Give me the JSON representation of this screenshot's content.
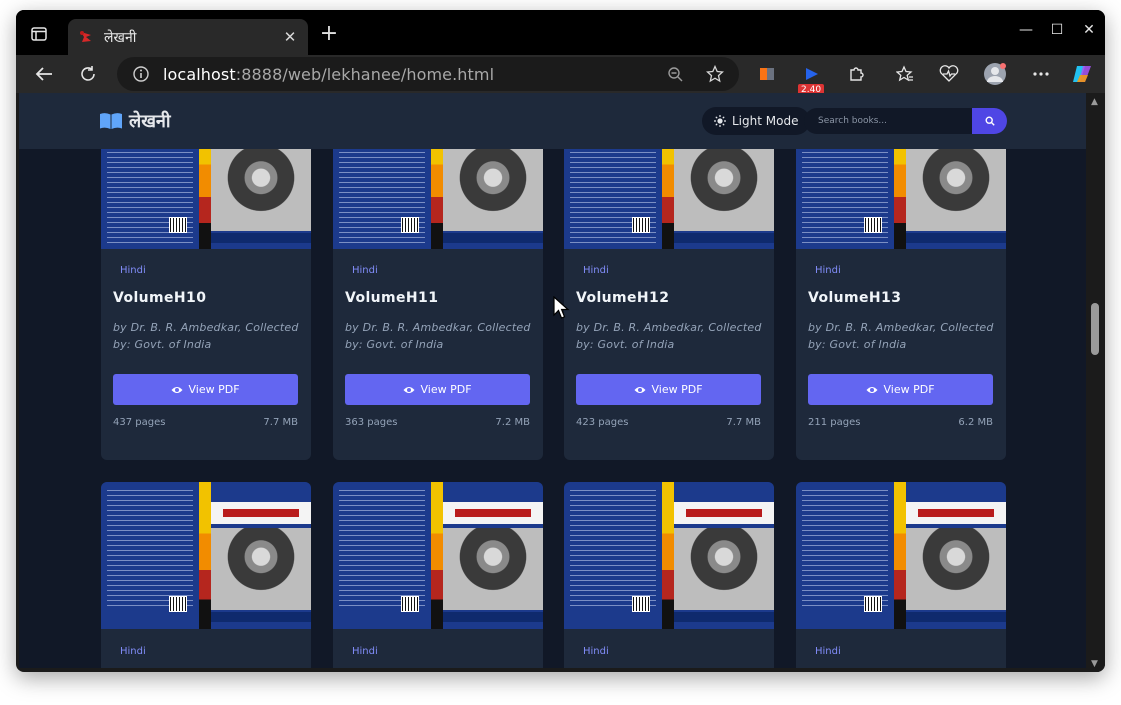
{
  "browser": {
    "tab_title": "लेखनी",
    "new_tab": "+",
    "url_host": "localhost",
    "url_path": ":8888/web/lekhanee/home.html",
    "extension_badge": "2.40",
    "window_controls": [
      "—",
      "☐",
      "✕"
    ]
  },
  "app": {
    "logo_text": "लेखनी",
    "mode_button": "Light Mode",
    "search_placeholder": "Search books..."
  },
  "books": [
    {
      "language": "Hindi",
      "title": "VolumeH10",
      "author": "by Dr. B. R. Ambedkar, Collected by: Govt. of India",
      "button": "View PDF",
      "pages": "437 pages",
      "size": "7.7 MB"
    },
    {
      "language": "Hindi",
      "title": "VolumeH11",
      "author": "by Dr. B. R. Ambedkar, Collected by: Govt. of India",
      "button": "View PDF",
      "pages": "363 pages",
      "size": "7.2 MB"
    },
    {
      "language": "Hindi",
      "title": "VolumeH12",
      "author": "by Dr. B. R. Ambedkar, Collected by: Govt. of India",
      "button": "View PDF",
      "pages": "423 pages",
      "size": "7.7 MB"
    },
    {
      "language": "Hindi",
      "title": "VolumeH13",
      "author": "by Dr. B. R. Ambedkar, Collected by: Govt. of India",
      "button": "View PDF",
      "pages": "211 pages",
      "size": "6.2 MB"
    }
  ],
  "next_row": [
    {
      "language": "Hindi"
    },
    {
      "language": "Hindi"
    },
    {
      "language": "Hindi"
    },
    {
      "language": "Hindi"
    }
  ],
  "colors": {
    "page_bg": "#111827",
    "card_bg": "#1e293b",
    "accent": "#6366f1",
    "language_tag": "#818cf8"
  }
}
